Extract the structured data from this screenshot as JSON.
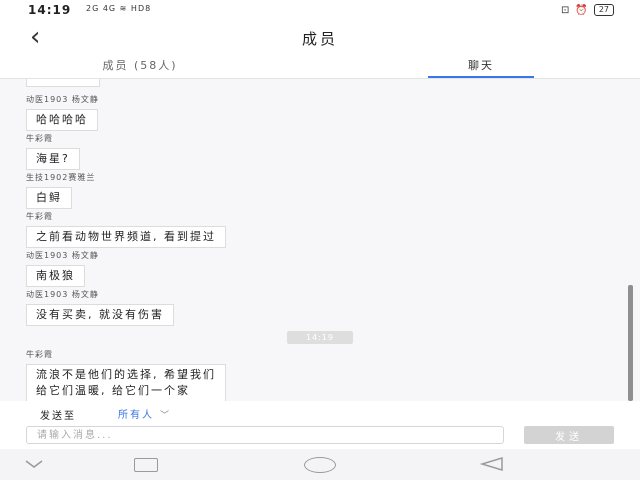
{
  "status_bar": {
    "time": "14:19",
    "signal_text": "2G 4G",
    "hd_label": "HD8",
    "battery": "27"
  },
  "header": {
    "title": "成员",
    "back_icon": "chevron-left-icon"
  },
  "tabs": [
    {
      "label": "成员 (58人)",
      "active": false
    },
    {
      "label": "聊天",
      "active": true
    }
  ],
  "messages": [
    {
      "sender": "动医1903 杨文静",
      "text": "哈哈哈哈"
    },
    {
      "sender": "牛彩霞",
      "text": "海星?"
    },
    {
      "sender": "生技1902赛雅兰",
      "text": "白鲟"
    },
    {
      "sender": "牛彩霞",
      "text": "之前看动物世界频道, 看到提过"
    },
    {
      "sender": "动医1903 杨文静",
      "text": "南极狼"
    },
    {
      "sender": "动医1903 杨文静",
      "text": "没有买卖, 就没有伤害"
    },
    {
      "sender": "牛彩霞",
      "text_lines": [
        "流浪不是他们的选择, 希望我们",
        "给它们温暖, 给它们一个家"
      ]
    }
  ],
  "time_divider": "14:19",
  "composer": {
    "send_to_label": "发送至",
    "recipient": "所有人",
    "input_placeholder": "请输入消息...",
    "send_button": "发送"
  },
  "colors": {
    "accent": "#3a76e6",
    "send_button_disabled": "#d3d3d3"
  }
}
